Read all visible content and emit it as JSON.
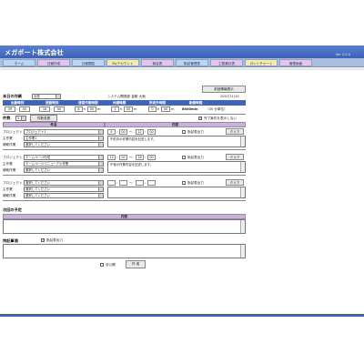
{
  "company": "メガポート株式会社",
  "version": "Ver 2.0.0",
  "nav": [
    "ホーム",
    "日報作成",
    "日報閲覧",
    "Myアカウント",
    "勤怠表",
    "勤怠管理表",
    "工数集計表",
    "ガントチャート",
    "管理画面"
  ],
  "nav_colors": [
    "#bcd6f2",
    "#e7c4e7",
    "#bcd6f2",
    "#f7eab0",
    "#e7c4e7",
    "#bcd6f2",
    "#e7c4e7",
    "#f7eab0",
    "#e7c4e7"
  ],
  "prev_report_btn": "前回情報表示",
  "today_label": "本日の作業",
  "work_type": "出勤",
  "dept_user": "システム開発部 金敷 大面",
  "date": "2007/11/10",
  "time_headers": [
    "出勤時刻",
    "退勤時刻",
    "通常作業時間",
    "休憩時間",
    "所定外時間",
    "勤務時間"
  ],
  "times": {
    "in_h": "09",
    "in_m": "00",
    "out_h": "18",
    "out_m": "00",
    "work_h": "8",
    "work_m": "00",
    "break_h": "1",
    "break_m": "00",
    "over_h": "0",
    "over_m": "00",
    "total": "8h00min",
    "total_note": "（30 分単位）"
  },
  "item_count_label": "件数",
  "item_count": "3",
  "item_change_btn": "件数変更",
  "show_completed_label": "完了案件を表示しない",
  "col_title": "件名",
  "col_content": "内容",
  "entries": [
    {
      "labels": [
        "プロジェクト",
        "主作業",
        "補助作業"
      ],
      "selects": [
        "プロジェクト1",
        "主作業1",
        "選択してください"
      ],
      "start_h": "9",
      "start_m": "00",
      "end_h": "12",
      "end_m": "00",
      "print_label": "勤怠表出力",
      "clear": "クリア",
      "content": "午前中の作業内容を記述します。"
    },
    {
      "labels": [
        "プロジェクト",
        "主作業",
        "補助作業"
      ],
      "selects": [
        "ホームページ作成",
        "ホームページリニューアル作業",
        "選択してください"
      ],
      "start_h": "13",
      "start_m": "00",
      "end_h": "18",
      "end_m": "00",
      "print_label": "勤怠表出力",
      "clear": "クリア",
      "content": "午後の作業内容を記述します。"
    },
    {
      "labels": [
        "プロジェクト",
        "主作業",
        "補助作業"
      ],
      "selects": [
        "選択してください",
        "選択してください",
        "選択してください"
      ],
      "start_h": "",
      "start_m": "",
      "end_h": "",
      "end_m": "",
      "print_label": "勤怠表出力",
      "clear": "クリア",
      "content": ""
    }
  ],
  "next_label": "次回の予定",
  "next_header": "内容",
  "notes_label": "特記事項",
  "notes_print_label": "勤怠表出力",
  "private_label": "非公開",
  "create_btn": "作 成"
}
